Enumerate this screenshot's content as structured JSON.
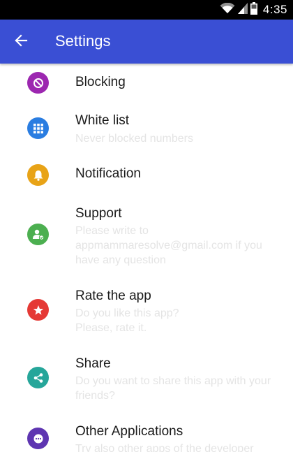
{
  "status_bar": {
    "time": "4:35",
    "icons": [
      "wifi-icon",
      "signal-icon",
      "battery-icon"
    ]
  },
  "app_bar": {
    "title": "Settings",
    "back_icon": "arrow-back-icon",
    "color": "#3a4fd4"
  },
  "settings": [
    {
      "title": "Blocking",
      "subtitle": "",
      "icon": "block-icon",
      "color": "#9c27b0"
    },
    {
      "title": "White list",
      "subtitle": "Never blocked numbers",
      "icon": "grid-icon",
      "color": "#2a7de1"
    },
    {
      "title": "Notification",
      "subtitle": "",
      "icon": "bell-icon",
      "color": "#e8a317"
    },
    {
      "title": "Support",
      "subtitle": "Please write to appmammaresolve@gmail.com if you have any question",
      "icon": "support-agent-icon",
      "color": "#4caf50"
    },
    {
      "title": "Rate the app",
      "subtitle": "Do you like this app? Please, rate it.",
      "icon": "star-icon",
      "color": "#e53935"
    },
    {
      "title": "Share",
      "subtitle": "Do you want to share this app with your friends?",
      "icon": "share-icon",
      "color": "#26a69a"
    },
    {
      "title": "Other Applications",
      "subtitle": "Try also other apps of the developer",
      "icon": "more-icon",
      "color": "#5e35b1"
    }
  ]
}
